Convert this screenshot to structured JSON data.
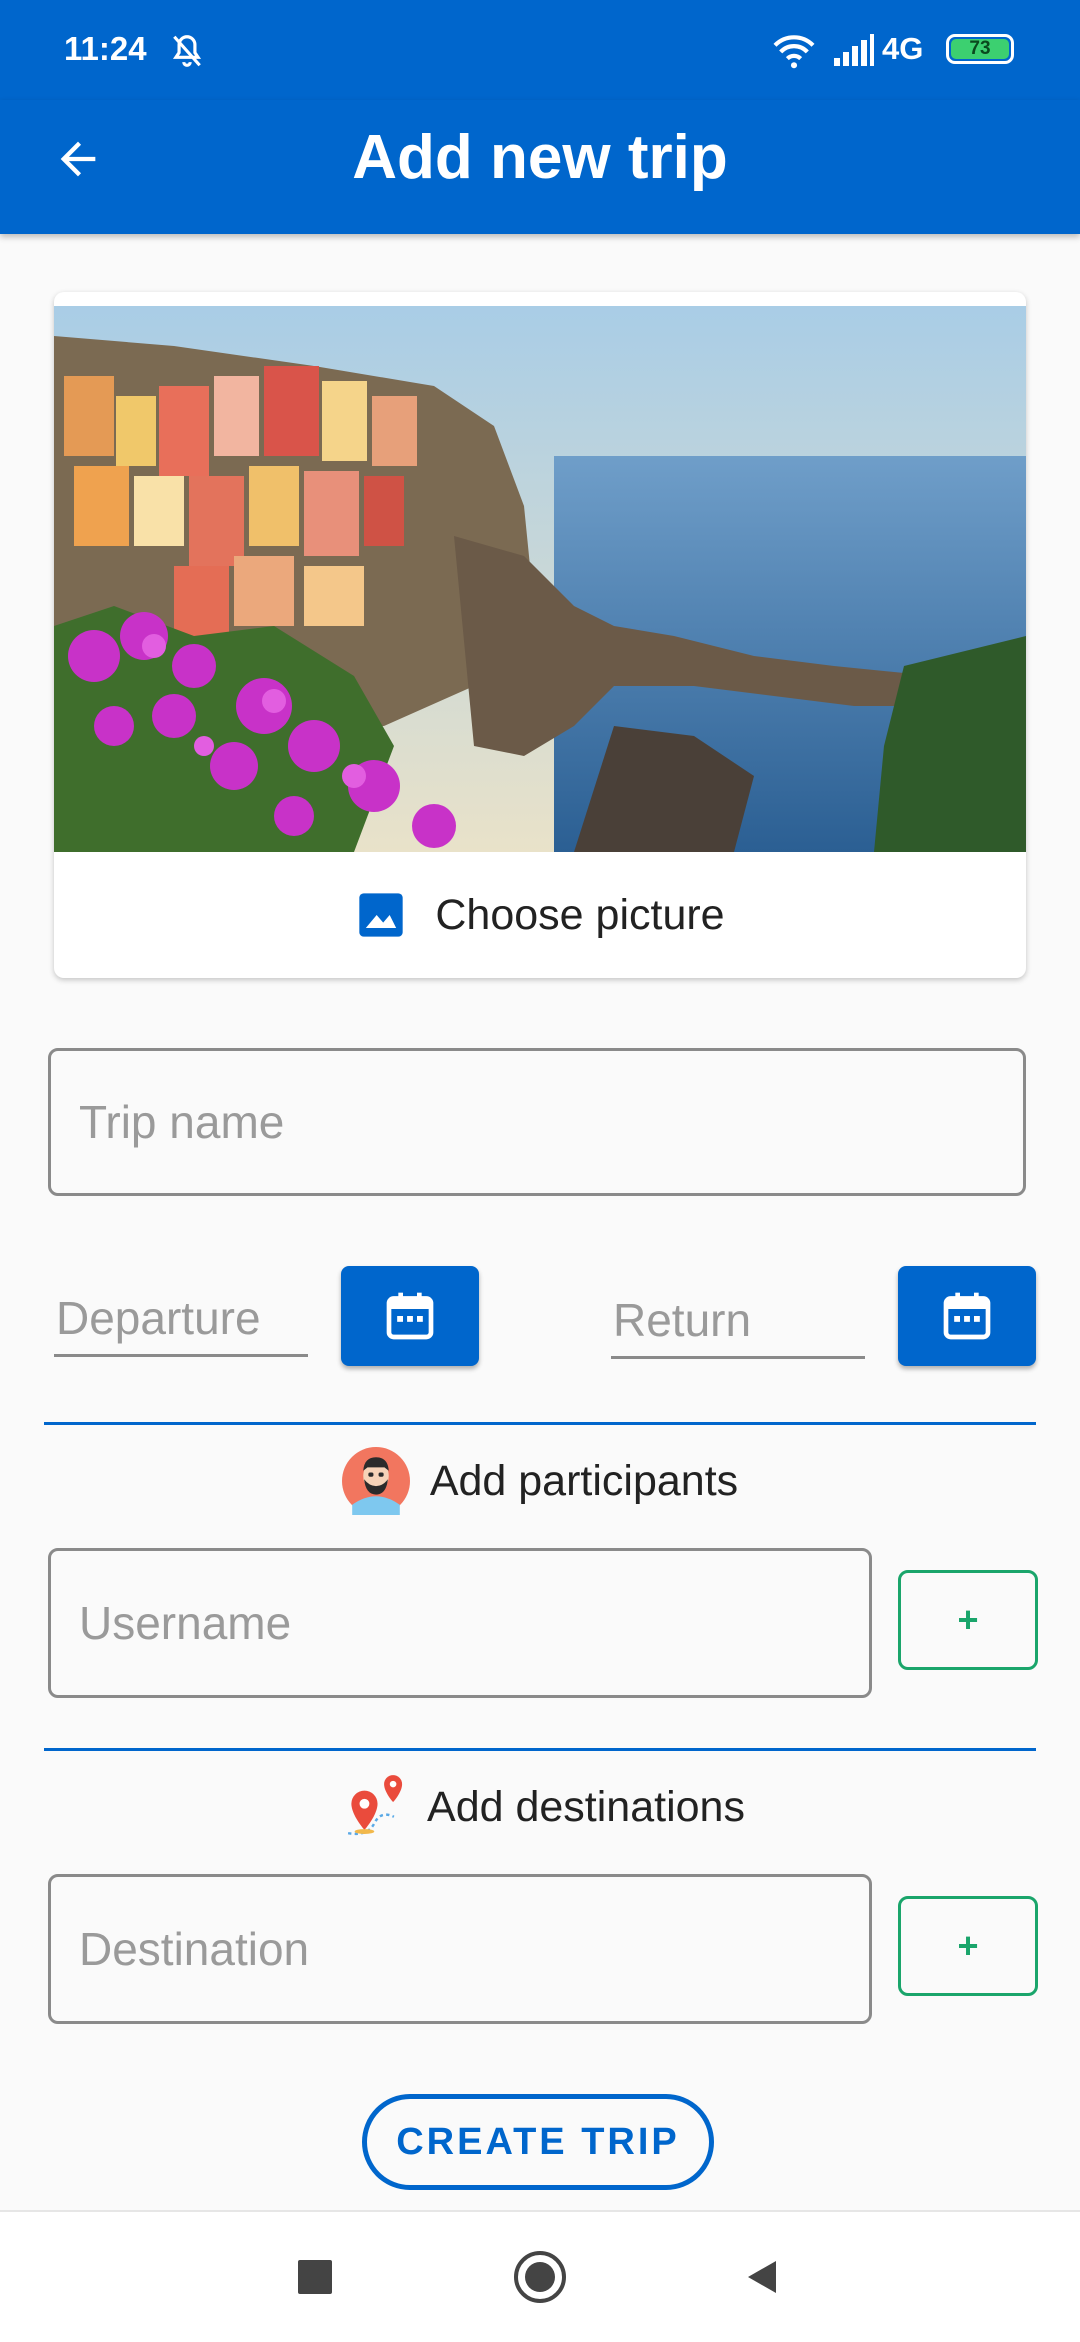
{
  "status_bar": {
    "time": "11:24",
    "network": "4G",
    "battery": "73"
  },
  "header": {
    "title": "Add new trip"
  },
  "picture_card": {
    "choose_label": "Choose picture"
  },
  "form": {
    "trip_name_placeholder": "Trip name",
    "departure_placeholder": "Departure",
    "return_placeholder": "Return",
    "participants_label": "Add participants",
    "username_placeholder": "Username",
    "destinations_label": "Add destinations",
    "destination_placeholder": "Destination",
    "add_label": "+",
    "create_label": "CREATE TRIP"
  },
  "colors": {
    "primary": "#0066CC",
    "add_green": "#1aa56b",
    "background": "#fafafa"
  },
  "icons": [
    "back-arrow-icon",
    "image-icon",
    "calendar-icon",
    "avatar-icon",
    "map-pin-icon",
    "nav-square-icon",
    "nav-home-icon",
    "nav-back-icon"
  ]
}
